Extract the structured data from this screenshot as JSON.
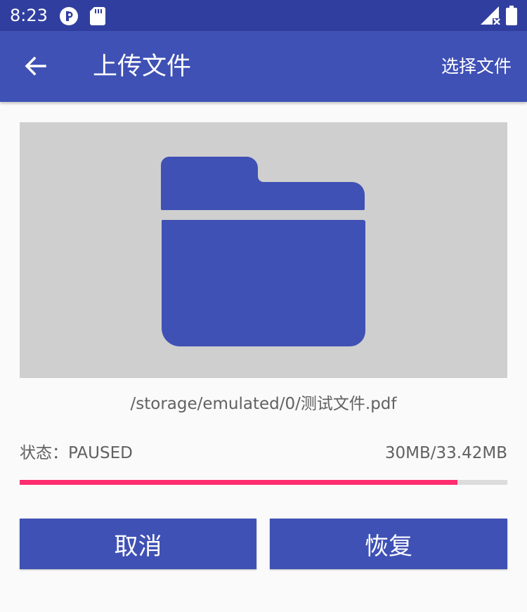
{
  "status_bar": {
    "time": "8:23",
    "icons": [
      "notification-p-icon",
      "sd-card-icon",
      "signal-off-icon",
      "battery-icon"
    ]
  },
  "app_bar": {
    "back_icon": "arrow-back-icon",
    "title": "上传文件",
    "select_file_label": "选择文件"
  },
  "preview": {
    "icon": "folder-icon"
  },
  "file": {
    "path": "/storage/emulated/0/测试文件.pdf"
  },
  "upload": {
    "status_text": "状态：PAUSED",
    "size_text": "30MB/33.42MB",
    "progress": 0.8977
  },
  "buttons": {
    "cancel_label": "取消",
    "resume_label": "恢复"
  },
  "colors": {
    "primary": "#3f51b5",
    "primary_dark": "#303f9f",
    "accent": "#ff2d6f",
    "preview_bg": "#cfcfcf"
  }
}
